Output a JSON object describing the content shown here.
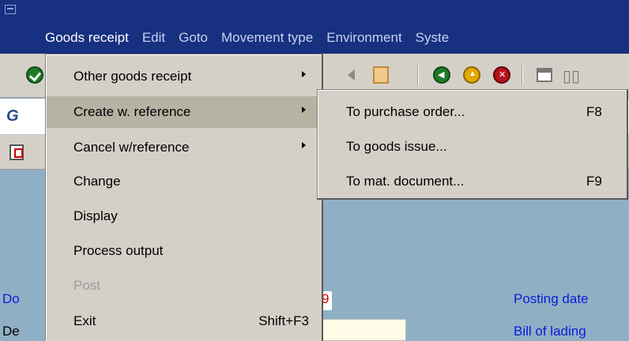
{
  "menubar": {
    "items": [
      {
        "label": "Goods receipt",
        "active": true
      },
      {
        "label": "Edit"
      },
      {
        "label": "Goto"
      },
      {
        "label": "Movement type"
      },
      {
        "label": "Environment"
      },
      {
        "label": "Syste"
      }
    ]
  },
  "title": {
    "visible_text": "G"
  },
  "dropdown": {
    "items": [
      {
        "label": "Other goods receipt",
        "has_submenu": true
      },
      {
        "label": "Create w. reference",
        "has_submenu": true,
        "highlighted": true
      },
      {
        "label": "Cancel w/reference",
        "has_submenu": true
      },
      {
        "label": "Change"
      },
      {
        "label": "Display"
      },
      {
        "label": "Process output"
      },
      {
        "label": "Post",
        "disabled": true
      },
      {
        "label": "Exit",
        "shortcut": "Shift+F3"
      }
    ]
  },
  "submenu": {
    "items": [
      {
        "label": "To purchase order...",
        "shortcut": "F8"
      },
      {
        "label": "To goods issue..."
      },
      {
        "label": "To mat. document...",
        "shortcut": "F9"
      }
    ]
  },
  "workarea": {
    "label_do": "Do",
    "label_de": "De",
    "value_9": "9",
    "posting_date": "Posting date",
    "bill_of_lading": "Bill of lading"
  }
}
